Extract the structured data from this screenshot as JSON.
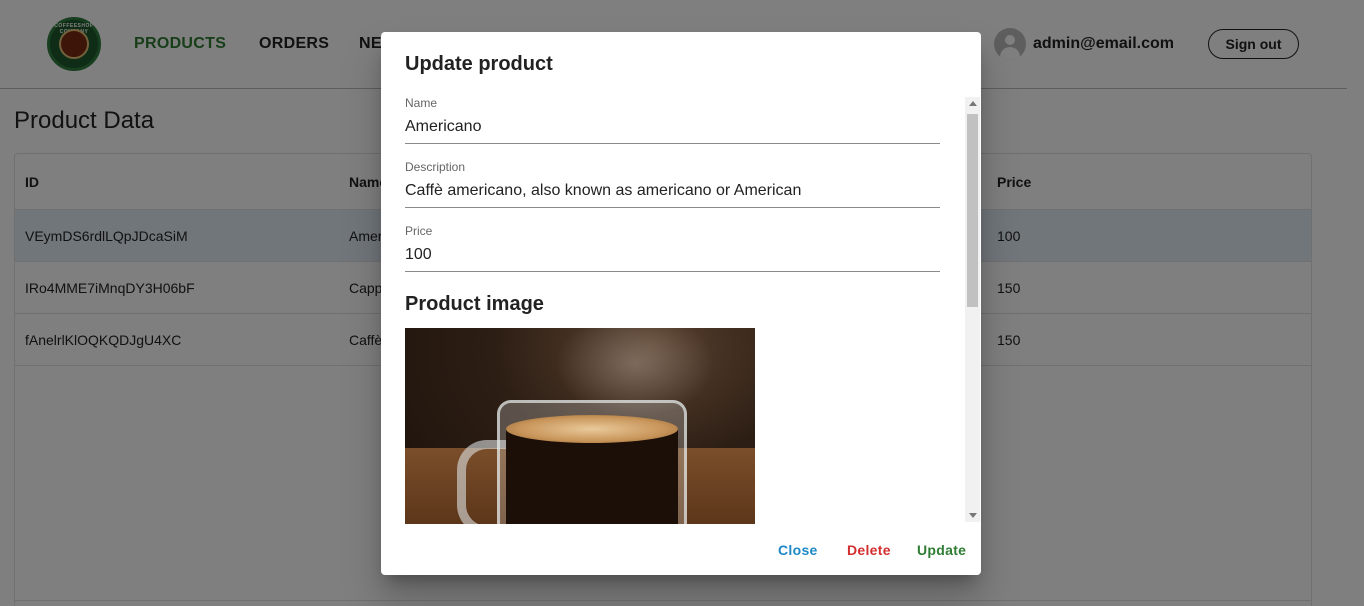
{
  "brand": {
    "logo_text": "COFFEESHOP COMPANY"
  },
  "nav": {
    "links": [
      {
        "label": "PRODUCTS",
        "active": true
      },
      {
        "label": "ORDERS",
        "active": false
      },
      {
        "label": "NE",
        "active": false
      }
    ],
    "user_email": "admin@email.com",
    "signout_label": "Sign out"
  },
  "page": {
    "title": "Product Data",
    "table": {
      "columns": {
        "id": "ID",
        "name": "Name",
        "price": "Price"
      },
      "rows": [
        {
          "id": "VEymDS6rdlLQpJDcaSiM",
          "name": "Amer",
          "price": "100",
          "selected": true
        },
        {
          "id": "IRo4MME7iMnqDY3H06bF",
          "name": "Capp",
          "price": "150",
          "selected": false
        },
        {
          "id": "fAnelrlKlOQKQDJgU4XC",
          "name": "Caffè",
          "price": "150",
          "selected": false
        }
      ]
    }
  },
  "dialog": {
    "title": "Update product",
    "fields": {
      "name": {
        "label": "Name",
        "value": "Americano"
      },
      "description": {
        "label": "Description",
        "value": "Caffè americano, also known as americano or American"
      },
      "price": {
        "label": "Price",
        "value": "100"
      }
    },
    "image_section_title": "Product image",
    "actions": {
      "close": "Close",
      "delete": "Delete",
      "update": "Update"
    }
  },
  "colors": {
    "accent_green": "#2e7d32",
    "close_blue": "#1e88c7",
    "delete_red": "#d32f2f",
    "selected_row": "#e3ecf6"
  }
}
